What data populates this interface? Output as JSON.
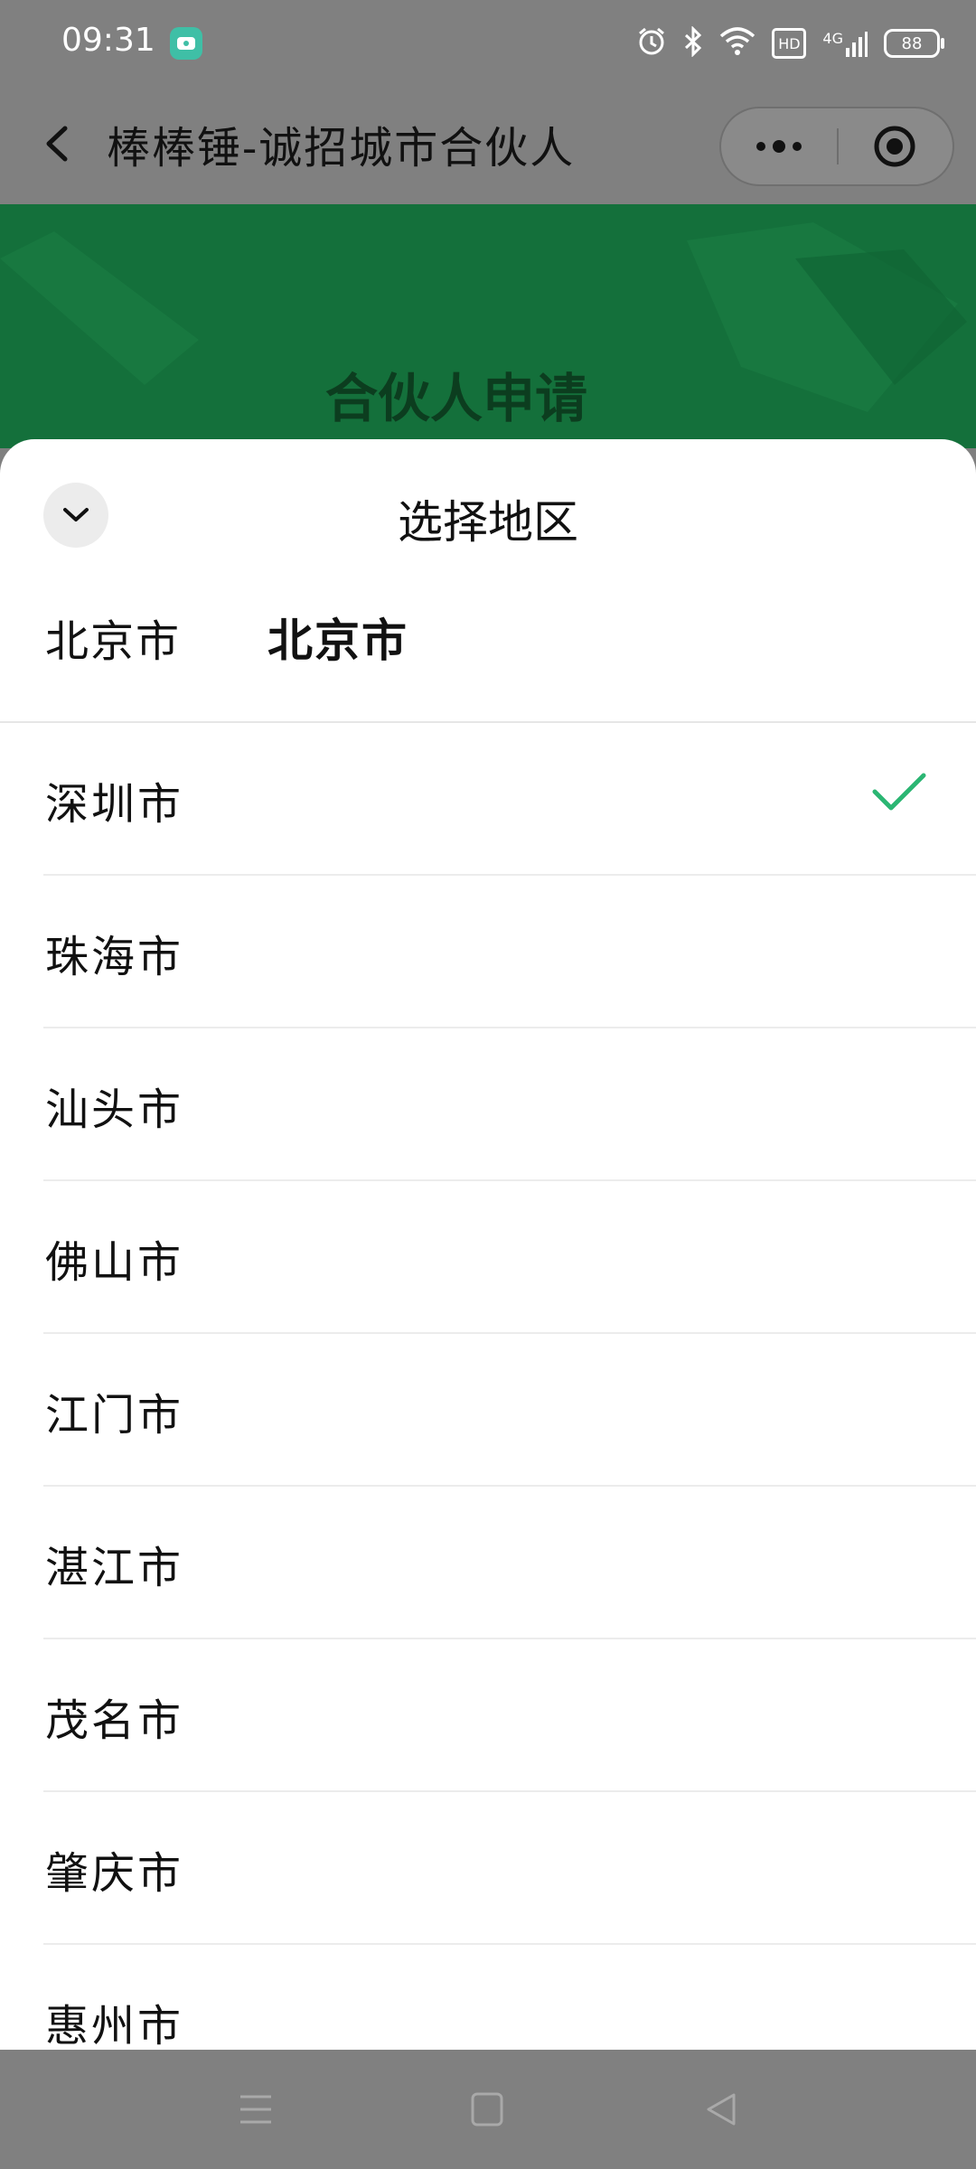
{
  "status_bar": {
    "time": "09:31",
    "network": "4G",
    "hd": "HD",
    "battery": "88",
    "icons": [
      "app-notification-icon",
      "alarm-icon",
      "bluetooth-icon",
      "wifi-icon",
      "hd-icon",
      "signal-icon",
      "battery-icon"
    ]
  },
  "title_bar": {
    "title": "棒棒锤-诚招城市合伙人",
    "back_icon": "chevron-left-icon",
    "more_icon": "more-dots-icon",
    "close_icon": "target-close-icon"
  },
  "banner": {
    "title": "合伙人申请",
    "color": "#14703b"
  },
  "sheet": {
    "title": "选择地区",
    "collapse_icon": "chevron-down-icon",
    "selected_province": "北京市",
    "selected_city": "北京市",
    "cities": [
      {
        "name": "深圳市",
        "checked": true
      },
      {
        "name": "珠海市",
        "checked": false
      },
      {
        "name": "汕头市",
        "checked": false
      },
      {
        "name": "佛山市",
        "checked": false
      },
      {
        "name": "江门市",
        "checked": false
      },
      {
        "name": "湛江市",
        "checked": false
      },
      {
        "name": "茂名市",
        "checked": false
      },
      {
        "name": "肇庆市",
        "checked": false
      },
      {
        "name": "惠州市",
        "checked": false
      }
    ],
    "check_color": "#2bb673"
  },
  "nav_bar": {
    "icons": [
      "menu-icon",
      "home-icon",
      "back-triangle-icon"
    ]
  }
}
